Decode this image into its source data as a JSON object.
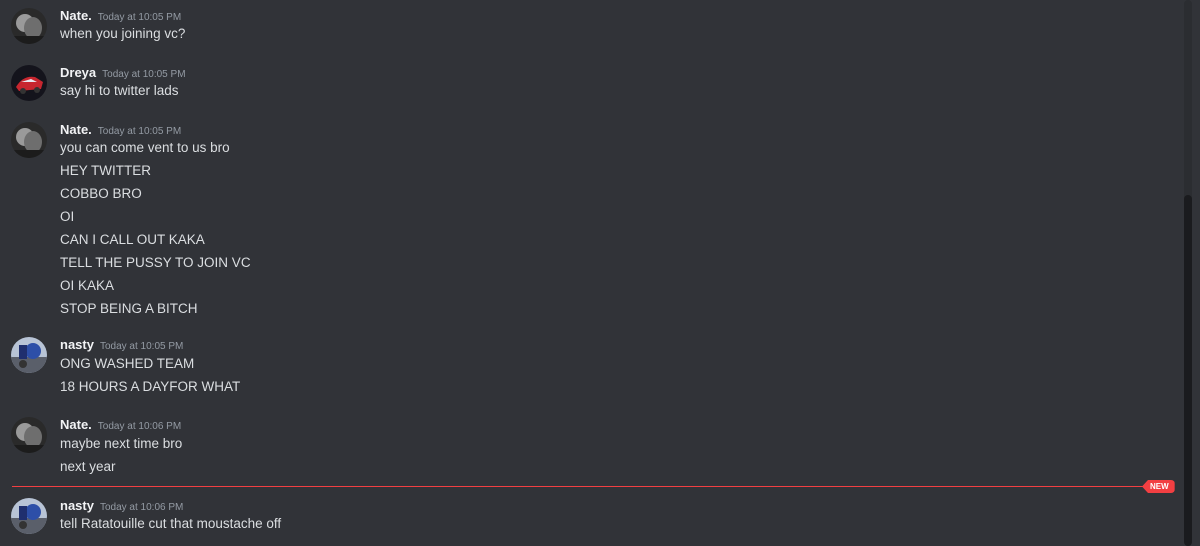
{
  "messages": [
    {
      "username": "Nate.",
      "timestamp": "Today at 10:05 PM",
      "avatar": "grayscale-face-avatar",
      "lines": [
        "when you joining vc?"
      ]
    },
    {
      "username": "Dreya",
      "timestamp": "Today at 10:05 PM",
      "avatar": "red-car-avatar",
      "lines": [
        "say hi to twitter lads"
      ]
    },
    {
      "username": "Nate.",
      "timestamp": "Today at 10:05 PM",
      "avatar": "grayscale-face-avatar",
      "lines": [
        "you can come vent to us bro",
        "HEY TWITTER",
        "COBBO BRO",
        "OI",
        "CAN I CALL OUT KAKA",
        "TELL THE PUSSY TO JOIN VC",
        "OI KAKA",
        "STOP BEING A BITCH"
      ]
    },
    {
      "username": "nasty",
      "timestamp": "Today at 10:05 PM",
      "avatar": "blue-scene-avatar",
      "lines": [
        "ONG WASHED TEAM",
        "18 HOURS A DAYFOR WHAT"
      ]
    },
    {
      "username": "Nate.",
      "timestamp": "Today at 10:06 PM",
      "avatar": "grayscale-face-avatar",
      "lines": [
        "maybe next time bro",
        "next year"
      ]
    },
    {
      "username": "nasty",
      "timestamp": "Today at 10:06 PM",
      "avatar": "blue-scene-avatar",
      "lines": [
        "tell Ratatouille cut that moustache off"
      ]
    }
  ],
  "divider": {
    "label": "NEW"
  },
  "colors": {
    "background": "#313338",
    "username": "#f2f3f5",
    "timestamp": "#949ba4",
    "message_text": "#dbdee1",
    "new_divider": "#f23f42"
  }
}
